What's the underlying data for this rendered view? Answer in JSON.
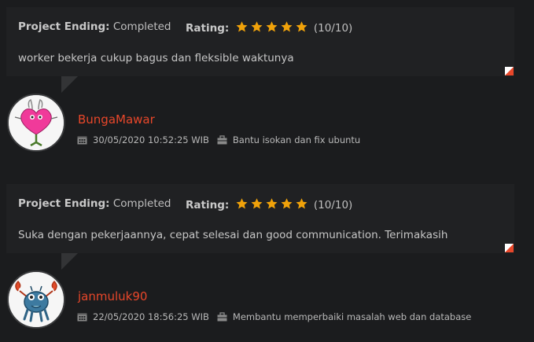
{
  "reviews": [
    {
      "ending_label": "Project Ending:",
      "ending_value": "Completed",
      "rating_label": "Rating:",
      "stars": 5,
      "score": "(10/10)",
      "comment": "worker bekerja cukup bagus dan fleksible waktunya",
      "username": "BungaMawar",
      "date": "30/05/2020 10:52:25 WIB",
      "project": "Bantu isokan dan fix ubuntu",
      "avatar": "pink-heart-creature-avatar"
    },
    {
      "ending_label": "Project Ending:",
      "ending_value": "Completed",
      "rating_label": "Rating:",
      "stars": 5,
      "score": "(10/10)",
      "comment": "Suka dengan pekerjaannya, cepat selesai dan good communication. Terimakasih",
      "username": "janmuluk90",
      "date": "22/05/2020 18:56:25 WIB",
      "project": "Membantu memperbaiki masalah web dan database",
      "avatar": "blue-crab-monster-avatar"
    }
  ],
  "colors": {
    "background": "#1b1c1e",
    "card": "#202123",
    "star": "#f0a20a",
    "username": "#e8472a"
  },
  "icons": {
    "star": "star-icon",
    "calendar": "calendar-icon",
    "briefcase": "briefcase-icon",
    "flag": "report-flag-icon"
  }
}
